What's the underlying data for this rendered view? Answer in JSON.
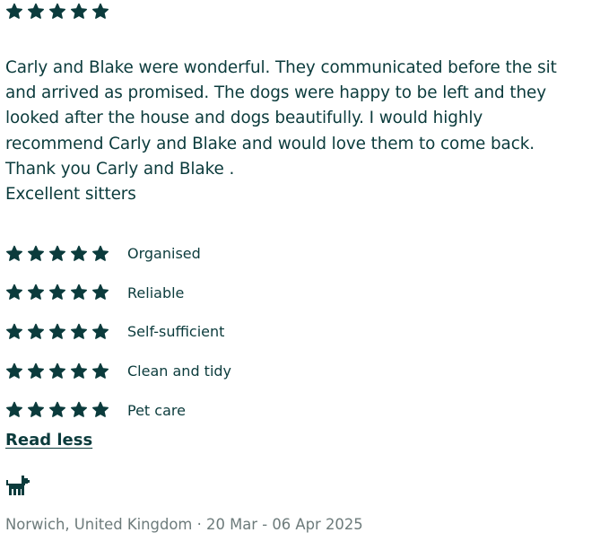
{
  "overall_rating": {
    "value": 5,
    "max": 5
  },
  "review": {
    "text": "Carly and Blake were wonderful. They communicated before the sit\nand arrived as promised. The dogs were happy to be left and they\nlooked after the house and dogs beautifully. I would highly\nrecommend Carly and Blake and would love them to come back.\nThank you Carly and Blake .\nExcellent sitters"
  },
  "categories": [
    {
      "label": "Organised",
      "rating": 5
    },
    {
      "label": "Reliable",
      "rating": 5
    },
    {
      "label": "Self-sufficient",
      "rating": 5
    },
    {
      "label": "Clean and tidy",
      "rating": 5
    },
    {
      "label": "Pet care",
      "rating": 5
    }
  ],
  "toggle": {
    "label": "Read less"
  },
  "pet": {
    "icon": "dog-icon"
  },
  "meta": {
    "location": "Norwich, United Kingdom",
    "separator": " · ",
    "dates": "20 Mar - 06 Apr 2025"
  },
  "colors": {
    "star": "#0b3b3c",
    "text": "#0b3b3c",
    "muted": "#6d7b7b"
  }
}
